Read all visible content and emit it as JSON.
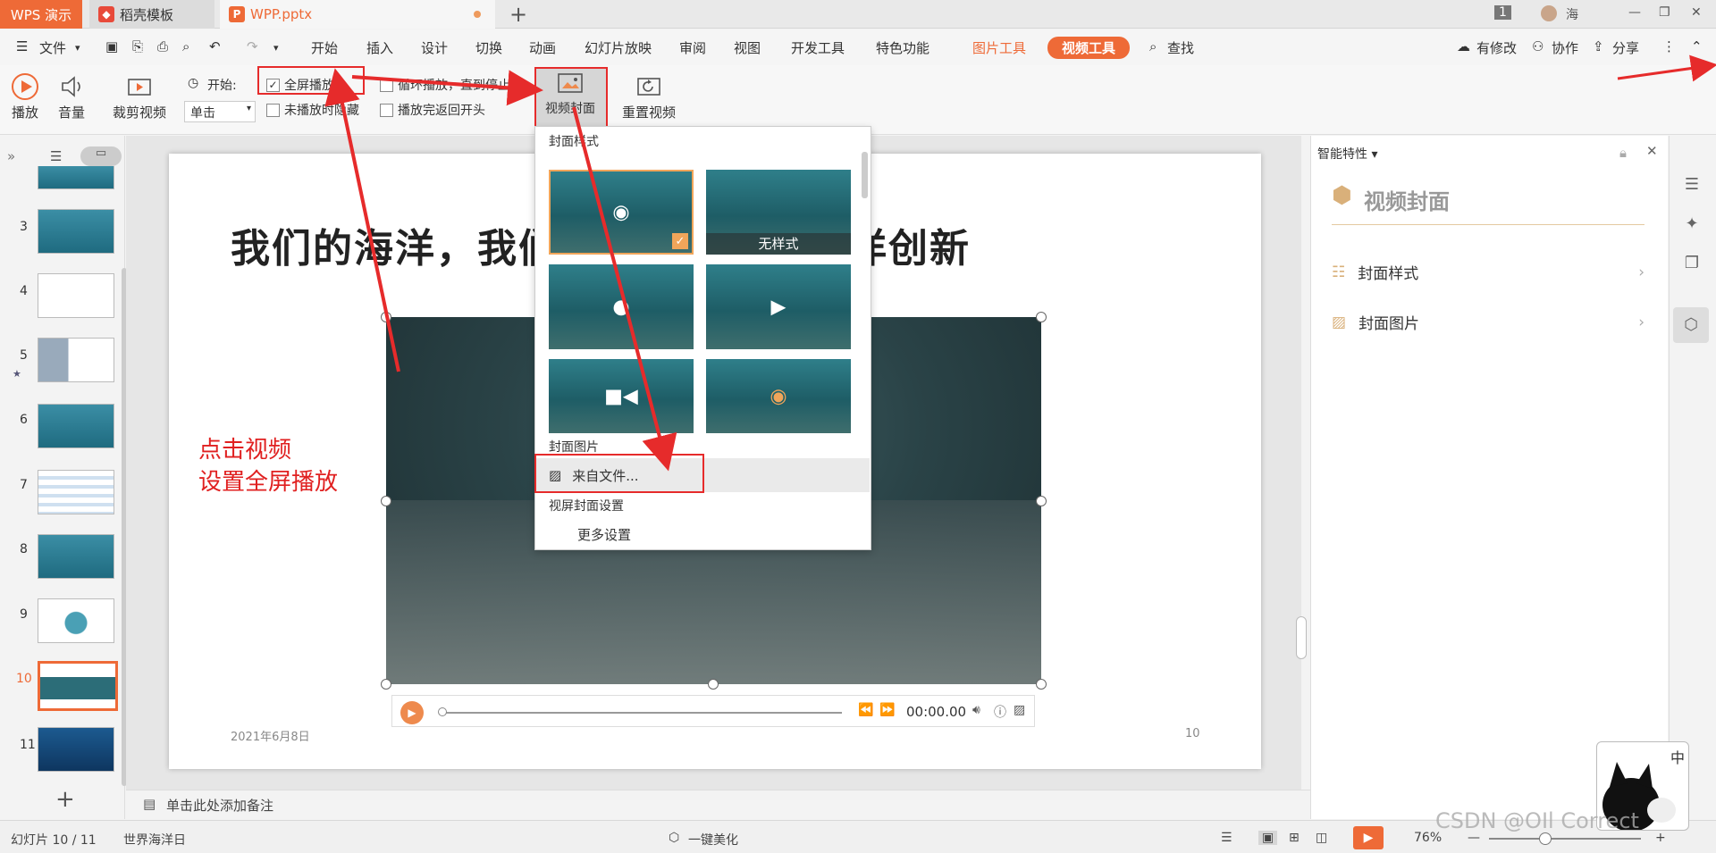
{
  "titlebar": {
    "tabs": [
      {
        "label": "WPS 演示"
      },
      {
        "label": "稻壳模板"
      },
      {
        "label": "WPP.pptx"
      }
    ],
    "new_tab": "+",
    "page_badge": "1",
    "user": "海"
  },
  "menubar": {
    "file": "文件",
    "items": [
      "开始",
      "插入",
      "设计",
      "切换",
      "动画",
      "幻灯片放映",
      "审阅",
      "视图",
      "开发工具",
      "特色功能"
    ],
    "picture_tools": "图片工具",
    "video_tools": "视频工具",
    "search": "查找",
    "has_changes": "有修改",
    "collaborate": "协作",
    "share": "分享"
  },
  "ribbon": {
    "play": "播放",
    "volume": "音量",
    "trim": "裁剪视频",
    "start_label": "开始:",
    "start_value": "单击",
    "fullscreen": "全屏播放",
    "loop": "循环播放，直到停止",
    "hide_unplayed": "未播放时隐藏",
    "rewind": "播放完返回开头",
    "cover": "视频封面",
    "reset": "重置视频"
  },
  "thumbnails": [
    {
      "num": "3"
    },
    {
      "num": "4"
    },
    {
      "num": "5"
    },
    {
      "num": "6"
    },
    {
      "num": "7"
    },
    {
      "num": "8"
    },
    {
      "num": "9"
    },
    {
      "num": "10"
    },
    {
      "num": "11"
    }
  ],
  "slide": {
    "title": "我们的海洋，我们的责任：持续海洋创新",
    "date": "2021年6月8日",
    "page": "10",
    "timecode": "00:00.00",
    "annotation_line1": "点击视频",
    "annotation_line2": "设置全屏播放"
  },
  "dropdown": {
    "section_style": "封面样式",
    "no_style": "无样式",
    "section_image": "封面图片",
    "from_file": "来自文件...",
    "section_settings": "视屏封面设置",
    "more_settings": "更多设置"
  },
  "rightpanel": {
    "header": "智能特性",
    "title": "视频封面",
    "items": [
      {
        "label": "封面样式"
      },
      {
        "label": "封面图片"
      }
    ]
  },
  "notes": {
    "placeholder": "单击此处添加备注"
  },
  "status": {
    "slide_info": "幻灯片 10 / 11",
    "theme": "世界海洋日",
    "beautify": "一键美化",
    "zoom": "76%"
  },
  "watermark": "CSDN @OIl Correct",
  "colors": {
    "accent": "#ee6a37",
    "annotation": "#e02020",
    "highlight": "#f0a55a"
  }
}
